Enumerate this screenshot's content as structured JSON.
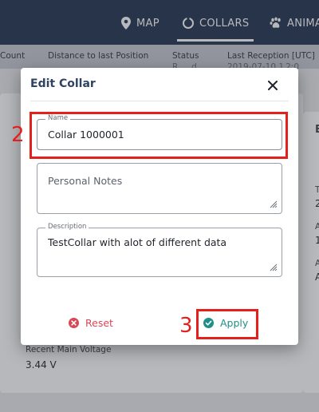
{
  "nav": {
    "map_label": "MAP",
    "collars_label": "COLLARS",
    "animals_label": "ANIMA"
  },
  "columns": {
    "count": "Count",
    "distance": "Distance to last Position",
    "status": "Status",
    "last_reception": "Last Reception [UTC]",
    "row_status_partial": "R        d",
    "row_reception_partial": "2019-07-10 1 2:0"
  },
  "background": {
    "recent_main_voltage_label": "Recent Main Voltage",
    "recent_main_voltage_value": "3.44 V",
    "right_card_letters": [
      "E",
      "T",
      "2",
      "A",
      "1",
      "A",
      "A"
    ]
  },
  "dialog": {
    "title": "Edit Collar",
    "close_icon": "close-icon",
    "name_field": {
      "legend": "Name",
      "value": "Collar 1000001"
    },
    "notes_field": {
      "placeholder": "Personal Notes"
    },
    "description_field": {
      "legend": "Description",
      "value": "TestCollar with alot of different data"
    },
    "reset_label": "Reset",
    "reset_icon": "cancel-circle-icon",
    "apply_label": "Apply",
    "apply_icon": "check-circle-icon"
  },
  "annotations": {
    "step_2": "2",
    "step_3": "3"
  },
  "colors": {
    "nav_bg": "#2d3d57",
    "title_color": "#2f4362",
    "reset_color": "#d84856",
    "apply_color": "#1e8f86",
    "annotation_red": "#e3201b"
  }
}
